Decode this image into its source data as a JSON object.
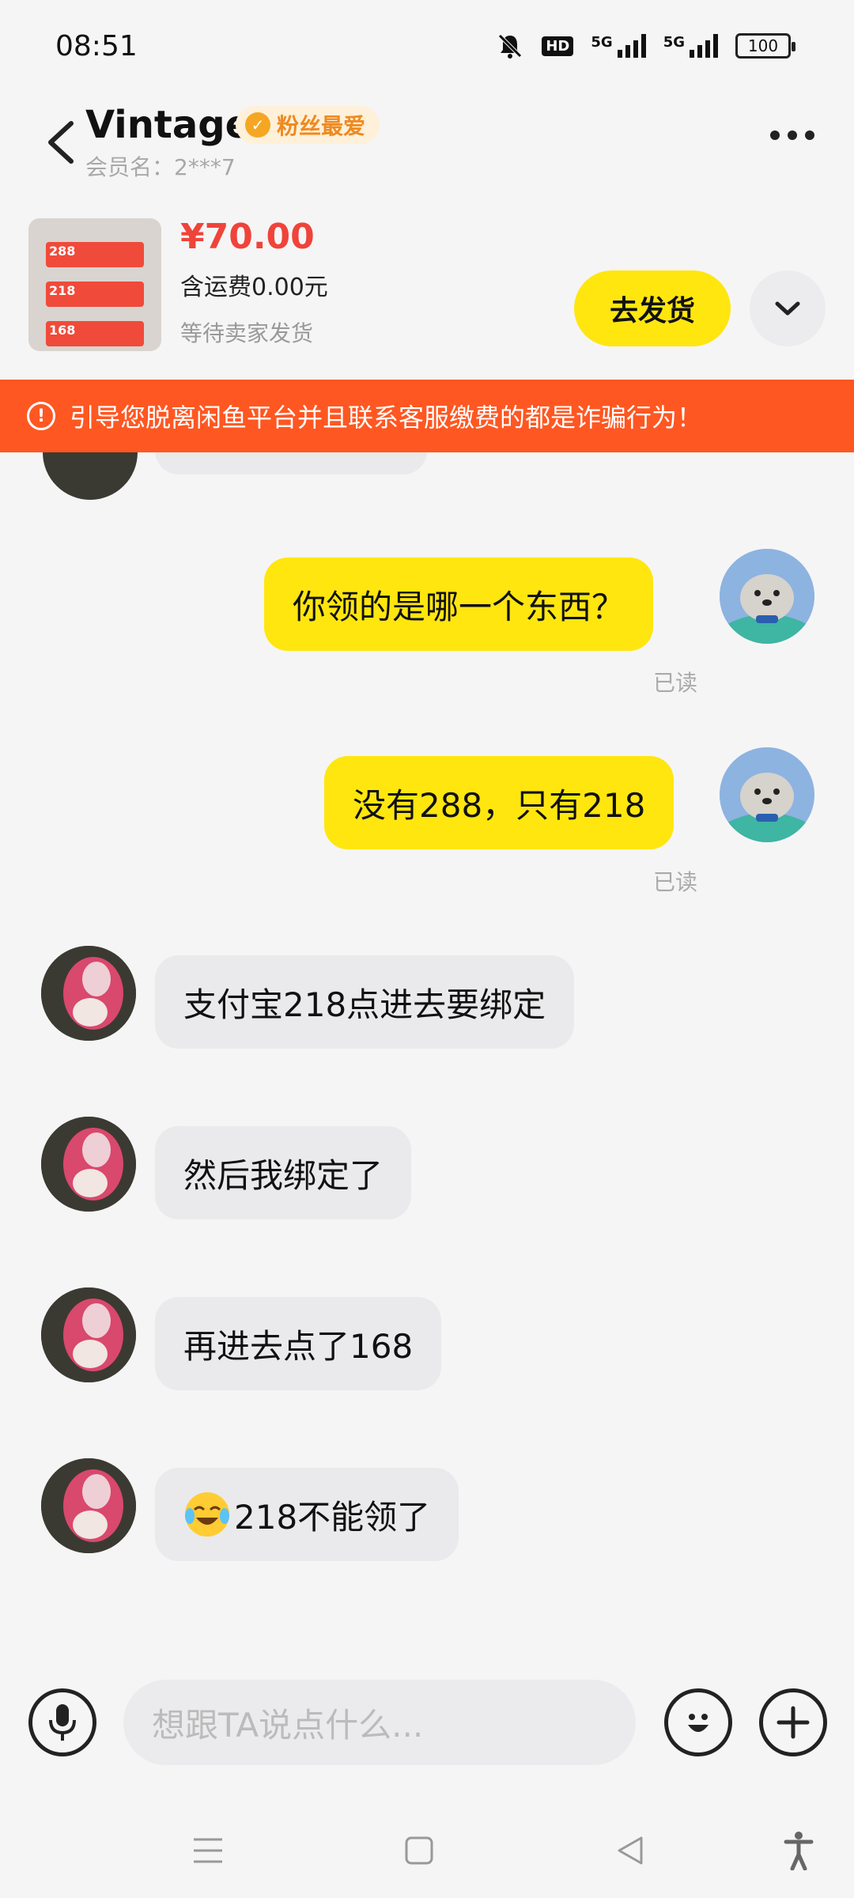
{
  "status_bar": {
    "time": "08:51",
    "hd_label": "HD",
    "net1": "5G",
    "net2": "5G",
    "battery": "100"
  },
  "header": {
    "title": "Vintage",
    "badge": "粉丝最爱",
    "member": "会员名：2***7"
  },
  "product": {
    "price": "¥70.00",
    "shipping": "含运费0.00元",
    "status": "等待卖家发货",
    "ship_button": "去发货",
    "thumb_rows": [
      "288",
      "218",
      "168"
    ]
  },
  "warning": {
    "text": "引导您脱离闲鱼平台并且联系客服缴费的都是诈骗行为！"
  },
  "messages": [
    {
      "sender": "me",
      "text": "你领的是哪一个东西？",
      "status": "已读"
    },
    {
      "sender": "me",
      "text": "没有288，只有218",
      "status": "已读"
    },
    {
      "sender": "them",
      "text": "支付宝218点进去要绑定"
    },
    {
      "sender": "them",
      "text": "然后我绑定了"
    },
    {
      "sender": "them",
      "text": "再进去点了168"
    },
    {
      "sender": "them",
      "text": "218不能领了",
      "emoji": "crying-laughing-emoji"
    }
  ],
  "input": {
    "placeholder": "想跟TA说点什么..."
  },
  "colors": {
    "accent_yellow": "#ffe60f",
    "price_red": "#f0433a",
    "warning_orange": "#ff5722"
  }
}
